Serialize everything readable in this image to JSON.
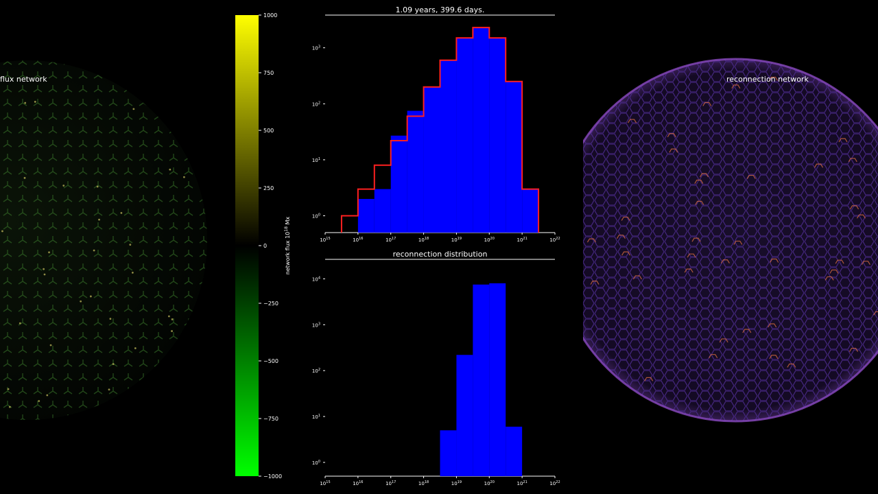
{
  "left_sphere": {
    "label": "flux network",
    "network_color": "#3a7a2a",
    "accent_color": "#c8c060"
  },
  "right_sphere": {
    "label": "reconnection network",
    "network_color": "#4a2a8a",
    "accent_color": "#e07040"
  },
  "colorbar": {
    "label": "network flux 10",
    "label_exponent": "18",
    "label_unit": " Mx",
    "ticks": [
      "1000",
      "750",
      "500",
      "250",
      "0",
      "−250",
      "−500",
      "−750",
      "−1000"
    ],
    "tick_values": [
      1000,
      750,
      500,
      250,
      0,
      -250,
      -500,
      -750,
      -1000
    ],
    "range": [
      -1000,
      1000
    ],
    "colors": {
      "top": "#ffff00",
      "mid": "#000000",
      "bottom": "#00ff00"
    }
  },
  "chart_data": [
    {
      "type": "bar",
      "title": "1.09 years, 399.6 days.",
      "x_scale": "log",
      "y_scale": "log",
      "xlim_exp": [
        15,
        22
      ],
      "ylim_exp": [
        -0.3,
        3.4
      ],
      "x_tick_exponents": [
        "15",
        "16",
        "17",
        "18",
        "19",
        "20",
        "21",
        "22"
      ],
      "y_tick_exponents": [
        "0",
        "1",
        "2",
        "3"
      ],
      "bin_edges_exp": [
        15.5,
        16,
        16.5,
        17,
        17.5,
        18,
        18.5,
        19,
        19.5,
        20,
        20.5,
        21,
        21.5
      ],
      "series": [
        {
          "color": "#0000ff",
          "style": "filled",
          "values": [
            0,
            2,
            3,
            27,
            75,
            200,
            600,
            1500,
            2300,
            1500,
            250,
            3
          ]
        },
        {
          "color": "#ff2020",
          "style": "step",
          "values": [
            1,
            3,
            8,
            22,
            60,
            200,
            600,
            1500,
            2300,
            1500,
            250,
            3
          ]
        }
      ]
    },
    {
      "type": "bar",
      "title": "reconnection distribution",
      "x_scale": "log",
      "y_scale": "log",
      "xlim_exp": [
        15,
        22
      ],
      "ylim_exp": [
        -0.3,
        4.2
      ],
      "x_tick_exponents": [
        "15",
        "16",
        "17",
        "18",
        "19",
        "20",
        "21",
        "22"
      ],
      "y_tick_exponents": [
        "0",
        "1",
        "2",
        "3",
        "4"
      ],
      "bin_edges_exp": [
        18.5,
        19,
        19.5,
        20,
        20.5,
        21
      ],
      "series": [
        {
          "color": "#0000ff",
          "style": "filled",
          "values": [
            5,
            220,
            7500,
            8000,
            6
          ]
        }
      ]
    }
  ]
}
